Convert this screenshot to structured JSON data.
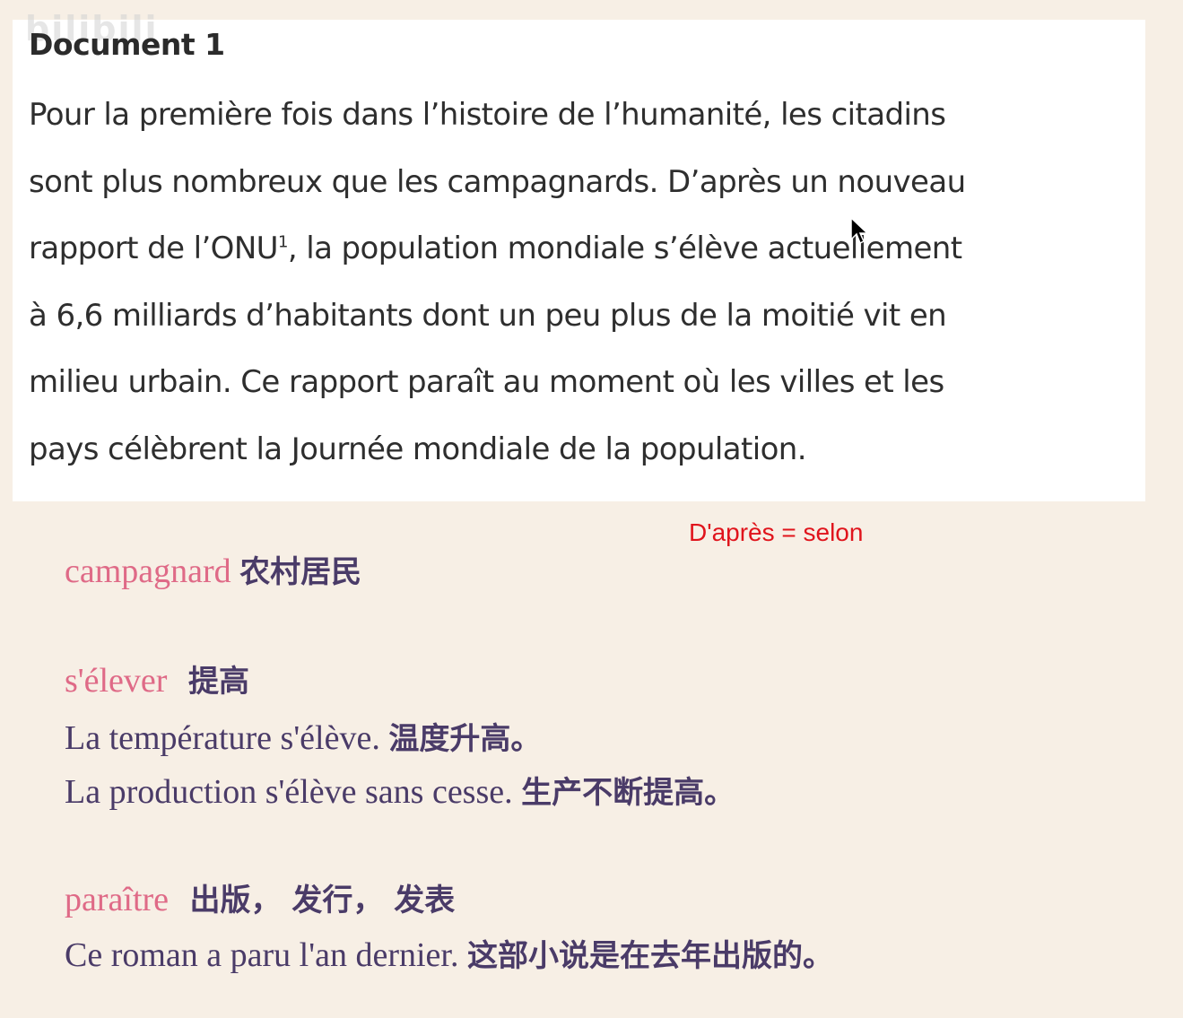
{
  "document": {
    "watermark": "bilibili",
    "title": "Document 1",
    "lines": [
      {
        "text": "Pour la première fois dans l’histoire de l’humanité, les citadins"
      },
      {
        "text": "sont plus nombreux que les campagnards. D’après un nouveau"
      },
      {
        "text_before": "rapport de l’ONU",
        "footnote": "1",
        "text_after": ", la population mondiale s’élève actuellement"
      },
      {
        "text": "à 6,6 milliards d’habitants dont un peu plus de la moitié vit en"
      },
      {
        "text": "milieu urbain. Ce rapport paraît au moment où les villes et les"
      },
      {
        "text": "pays célèbrent la Journée mondiale de la population."
      }
    ]
  },
  "annotation": "D'après = selon",
  "vocabulary": {
    "campagnard": {
      "term": "campagnard",
      "translation": "农村居民"
    },
    "selever": {
      "term": "s'élever",
      "translation": "提高",
      "examples": [
        {
          "fr": "La température s'élève.",
          "zh": "温度升高。"
        },
        {
          "fr": "La production s'élève sans cesse.",
          "zh": "生产不断提高。"
        }
      ]
    },
    "paraitre": {
      "term": "paraître",
      "translation": "出版， 发行， 发表",
      "examples": [
        {
          "fr": "Ce roman a paru l'an dernier.",
          "zh": "这部小说是在去年出版的。"
        }
      ]
    }
  },
  "colors": {
    "background": "#f7efe5",
    "term": "#df6a87",
    "body_text": "#4a3b68",
    "annotation": "#e0141c"
  }
}
